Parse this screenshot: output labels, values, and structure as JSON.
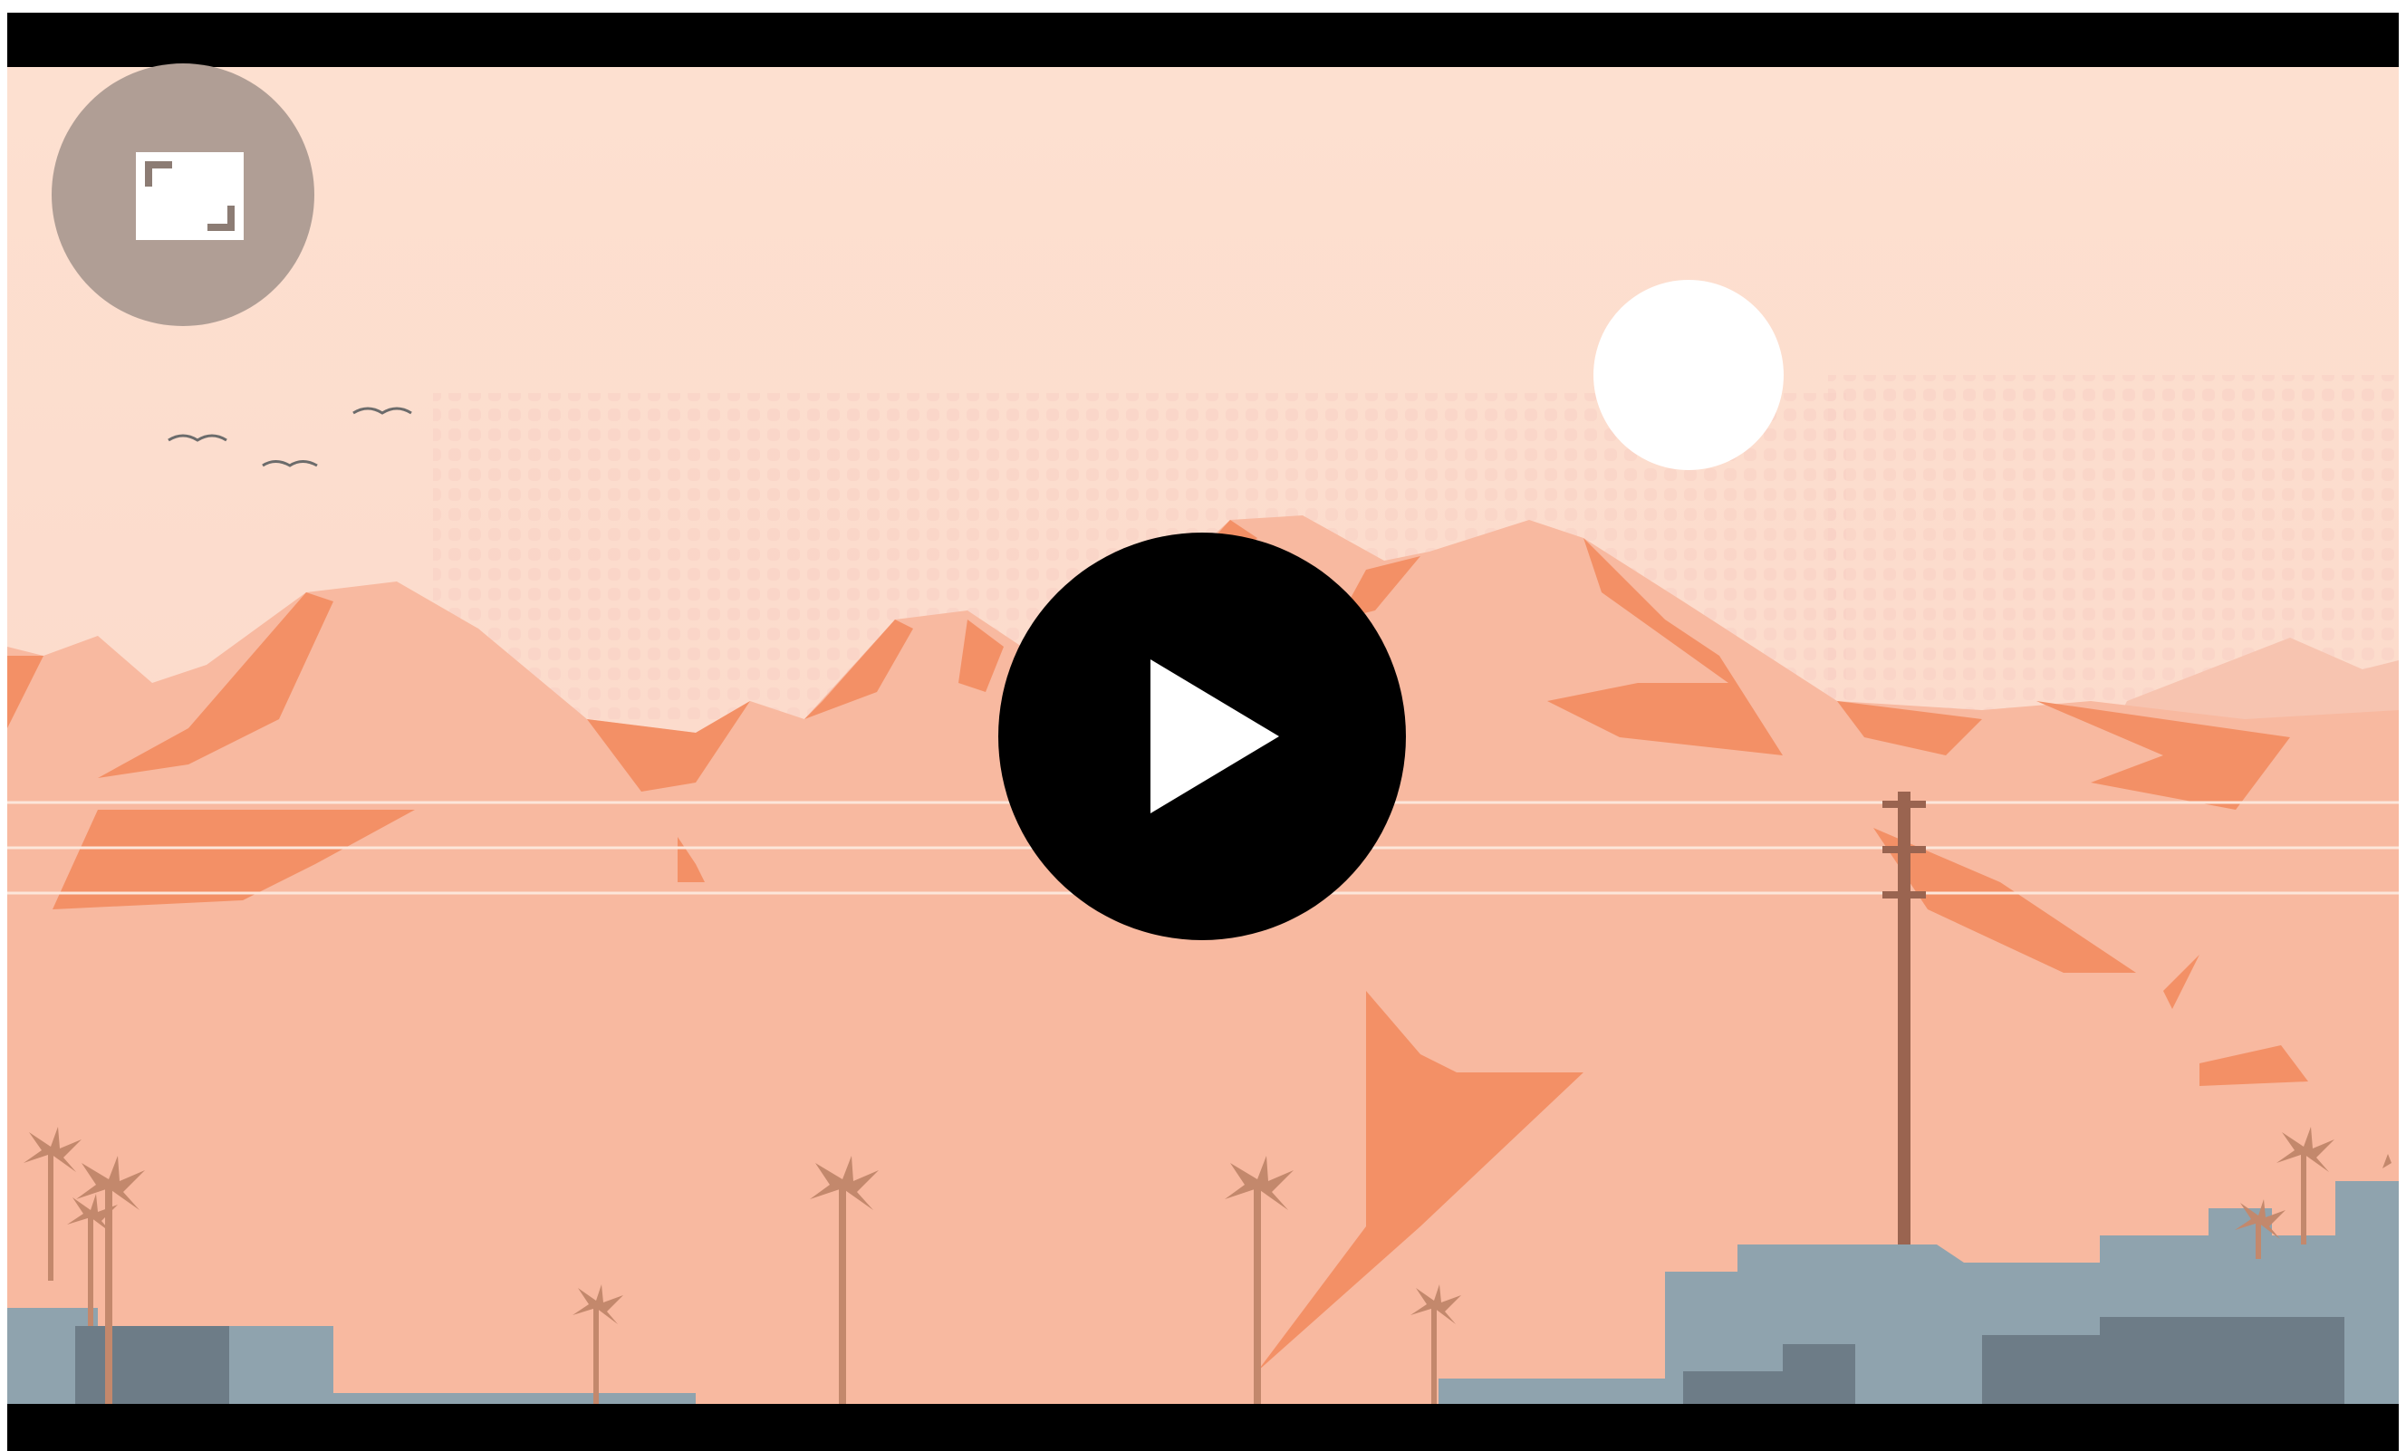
{
  "player": {
    "state": "paused",
    "letterbox_color": "#000000"
  },
  "controls": {
    "fullscreen": {
      "icon": "fullscreen-icon",
      "color": "#b09e95"
    },
    "play": {
      "icon": "play-icon",
      "color": "#000000"
    }
  },
  "scene": {
    "sky_color": "#fde0d0",
    "sun_color": "#ffffff",
    "mountain_color": "#f8b9a0",
    "mountain_shadow_color": "#f39066",
    "ground_color": "#f8b69a",
    "palm_color": "#c3886c",
    "pole_color": "#9a6450",
    "building_light_color": "#8fa3ae",
    "building_dark_color": "#6d7c87"
  }
}
